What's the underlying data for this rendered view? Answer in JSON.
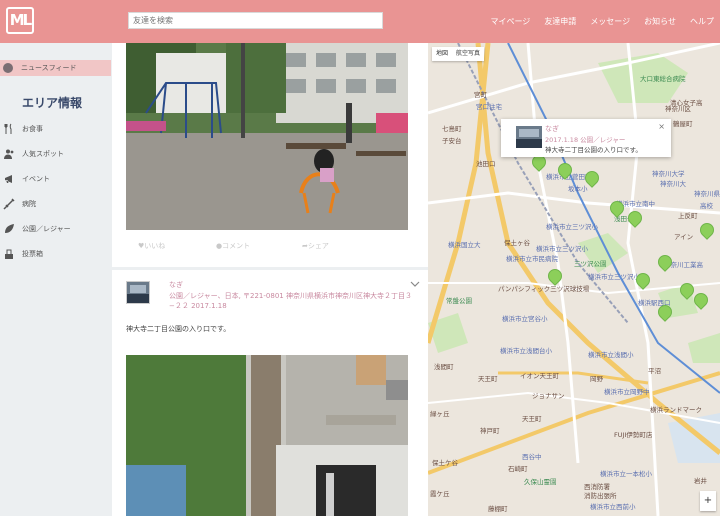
{
  "header": {
    "logo": "ML",
    "search_placeholder": "友達を検索",
    "nav": [
      "マイページ",
      "友達申請",
      "メッセージ",
      "お知らせ",
      "ヘルプ"
    ]
  },
  "sidebar": {
    "newsfeed": "ニュースフィード",
    "area_title": "エリア情報",
    "categories": [
      {
        "label": "お食事",
        "icon": "utensils-icon"
      },
      {
        "label": "人気スポット",
        "icon": "people-icon"
      },
      {
        "label": "イベント",
        "icon": "megaphone-icon"
      },
      {
        "label": "病院",
        "icon": "syringe-icon"
      },
      {
        "label": "公園／レジャー",
        "icon": "leaf-icon"
      },
      {
        "label": "投票箱",
        "icon": "ballot-box-icon"
      }
    ]
  },
  "feed": {
    "actions": {
      "like": "いいね",
      "comment": "コメント",
      "share": "シェア"
    },
    "post": {
      "author": "なぎ",
      "meta": "公園／レジャー、日本, 〒221-0801 神奈川県横浜市神奈川区神大寺２丁目３−２２ 2017.1.18",
      "text": "神大寺二丁目公園の入り口です。"
    }
  },
  "map": {
    "types": [
      "地図",
      "航空写真"
    ],
    "popup": {
      "name": "なぎ",
      "meta": "2017.1.18 公園／レジャー",
      "text": "神大寺二丁目公園の入り口です。",
      "close": "×"
    },
    "labels": [
      "大口東総合病院",
      "宮町",
      "宮口住宅",
      "七島町",
      "子安台",
      "神奈川区",
      "鶴屋町",
      "神奈川大学",
      "横浜市立菅田町小",
      "池田口",
      "神奈川大",
      "坂本小",
      "浅田公園",
      "横浜市立南中",
      "神奈川県立",
      "高校",
      "清心女子高",
      "上反町",
      "横浜市立三ツ沢小",
      "アイン",
      "横浜国立大",
      "横浜市立市民病院",
      "保土ヶ谷",
      "三ツ沢公園",
      "横浜市立三ツ沢小",
      "横浜市立三ツ沢小",
      "神奈川工業高",
      "常盤公園",
      "パンパシフィック三ツ沢球技場",
      "横浜駅西口",
      "横浜市立宮谷小",
      "横浜市立浅間台小",
      "浅間町",
      "横浜市立浅間小",
      "イオン天王町",
      "天王町",
      "ジョナサン",
      "横浜市立岡野中",
      "平沼",
      "岡野",
      "横浜ランドマーク",
      "神戸町",
      "天王町",
      "緑ヶ丘",
      "FUJI伊勢町店",
      "保土ケ谷",
      "西谷中",
      "石崎町",
      "横浜市立一本松小",
      "久保山霊園",
      "西消防署",
      "消防出張所",
      "横浜市立西前小",
      "藤棚町",
      "霞ケ丘",
      "岩井"
    ],
    "zoom_in": "+"
  }
}
